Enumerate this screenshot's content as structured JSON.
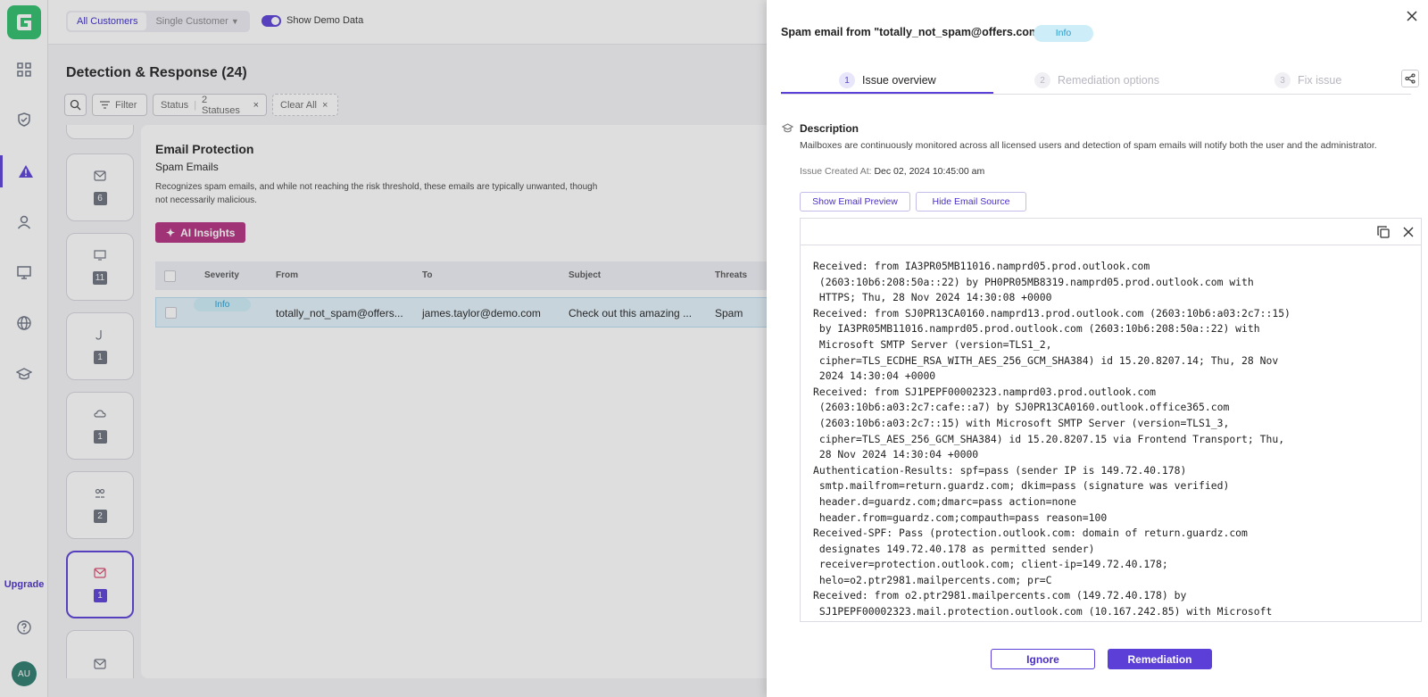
{
  "sidebar": {
    "upgrade_label": "Upgrade",
    "avatar_initials": "AU",
    "nav_icons": [
      "dashboard-icon",
      "shield-icon",
      "alert-icon",
      "user-icon",
      "monitor-icon",
      "globe-icon",
      "graduation-cap-icon"
    ],
    "help_icon": "help-icon"
  },
  "topbar": {
    "segment_all": "All Customers",
    "segment_single": "Single Customer",
    "demo_label": "Show Demo Data",
    "demo_on": true
  },
  "page": {
    "title": "Detection & Response (24)",
    "filter_label": "Filter",
    "status_label": "Status",
    "status_value": "2 Statuses",
    "clear_all": "Clear All"
  },
  "cards": [
    {
      "icon": "mail-icon",
      "count": "6"
    },
    {
      "icon": "monitor-icon",
      "count": "11"
    },
    {
      "icon": "file-icon",
      "count": "1"
    },
    {
      "icon": "cloud-icon",
      "count": "1"
    },
    {
      "icon": "people-icon",
      "count": "2"
    },
    {
      "icon": "mail-icon",
      "count": "1",
      "active": true
    },
    {
      "icon": "mail-icon",
      "count": ""
    }
  ],
  "detail": {
    "heading": "Email Protection",
    "subheading": "Spam Emails",
    "description": "Recognizes spam emails, and while not reaching the risk threshold, these emails are typically unwanted, though not necessarily malicious.",
    "ai_insights": "AI Insights",
    "columns": [
      "Severity",
      "From",
      "To",
      "Subject",
      "Threats"
    ],
    "row": {
      "severity": "Info",
      "from": "totally_not_spam@offers...",
      "to": "james.taylor@demo.com",
      "subject": "Check out this amazing ...",
      "threats": "Spam"
    }
  },
  "drawer": {
    "title": "Spam email from \"totally_not_spam@offers.com\"",
    "badge": "Info",
    "steps": [
      {
        "num": "1",
        "label": "Issue overview",
        "active": true
      },
      {
        "num": "2",
        "label": "Remediation options"
      },
      {
        "num": "3",
        "label": "Fix issue"
      }
    ],
    "description_label": "Description",
    "description_text": "Mailboxes are continuously monitored across all licensed users and detection of spam emails will notify both the user and the administrator.",
    "created_key": "Issue Created At:",
    "created_value": "Dec 02, 2024 10:45:00 am",
    "show_preview": "Show Email Preview",
    "hide_source": "Hide Email Source",
    "email_source": "Received: from IA3PR05MB11016.namprd05.prod.outlook.com\n (2603:10b6:208:50a::22) by PH0PR05MB8319.namprd05.prod.outlook.com with\n HTTPS; Thu, 28 Nov 2024 14:30:08 +0000\nReceived: from SJ0PR13CA0160.namprd13.prod.outlook.com (2603:10b6:a03:2c7::15)\n by IA3PR05MB11016.namprd05.prod.outlook.com (2603:10b6:208:50a::22) with\n Microsoft SMTP Server (version=TLS1_2,\n cipher=TLS_ECDHE_RSA_WITH_AES_256_GCM_SHA384) id 15.20.8207.14; Thu, 28 Nov\n 2024 14:30:04 +0000\nReceived: from SJ1PEPF00002323.namprd03.prod.outlook.com\n (2603:10b6:a03:2c7:cafe::a7) by SJ0PR13CA0160.outlook.office365.com\n (2603:10b6:a03:2c7::15) with Microsoft SMTP Server (version=TLS1_3,\n cipher=TLS_AES_256_GCM_SHA384) id 15.20.8207.15 via Frontend Transport; Thu,\n 28 Nov 2024 14:30:04 +0000\nAuthentication-Results: spf=pass (sender IP is 149.72.40.178)\n smtp.mailfrom=return.guardz.com; dkim=pass (signature was verified)\n header.d=guardz.com;dmarc=pass action=none\n header.from=guardz.com;compauth=pass reason=100\nReceived-SPF: Pass (protection.outlook.com: domain of return.guardz.com\n designates 149.72.40.178 as permitted sender)\n receiver=protection.outlook.com; client-ip=149.72.40.178;\n helo=o2.ptr2981.mailpercents.com; pr=C\nReceived: from o2.ptr2981.mailpercents.com (149.72.40.178) by\n SJ1PEPF00002323.mail.protection.outlook.com (10.167.242.85) with Microsoft",
    "ignore_label": "Ignore",
    "remediation_label": "Remediation"
  }
}
